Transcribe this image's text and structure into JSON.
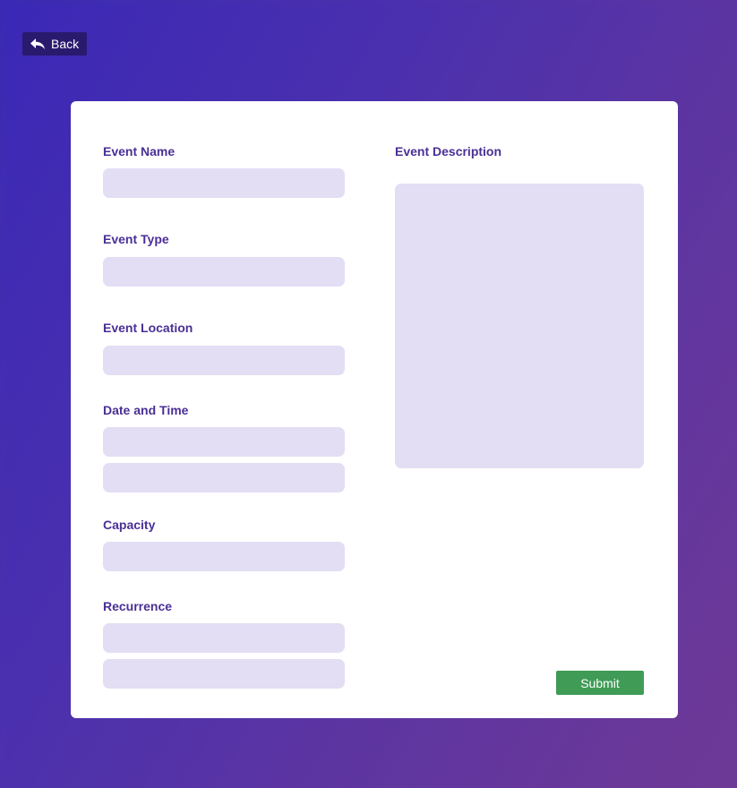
{
  "nav": {
    "back_label": "Back"
  },
  "form": {
    "event_name": {
      "label": "Event Name",
      "value": "",
      "placeholder": ""
    },
    "event_type": {
      "label": "Event Type",
      "value": "",
      "placeholder": ""
    },
    "event_location": {
      "label": "Event Location",
      "value": "",
      "placeholder": ""
    },
    "date_time": {
      "label": "Date and Time",
      "date": {
        "value": "",
        "placeholder": ""
      },
      "time": {
        "value": "",
        "placeholder": ""
      }
    },
    "capacity": {
      "label": "Capacity",
      "value": "",
      "placeholder": ""
    },
    "recurrence": {
      "label": "Recurrence",
      "first": {
        "value": "",
        "placeholder": ""
      },
      "second": {
        "value": "",
        "placeholder": ""
      }
    },
    "event_description": {
      "label": "Event Description",
      "value": "",
      "placeholder": ""
    },
    "submit_label": "Submit"
  },
  "icons": {
    "back": "reply-arrow-icon"
  },
  "colors": {
    "background_start": "#3b28b6",
    "background_end": "#6e3996",
    "label": "#4a2f96",
    "field_fill": "#e3def4",
    "submit": "#3f9b56",
    "back_button": "#2a1a6e"
  }
}
